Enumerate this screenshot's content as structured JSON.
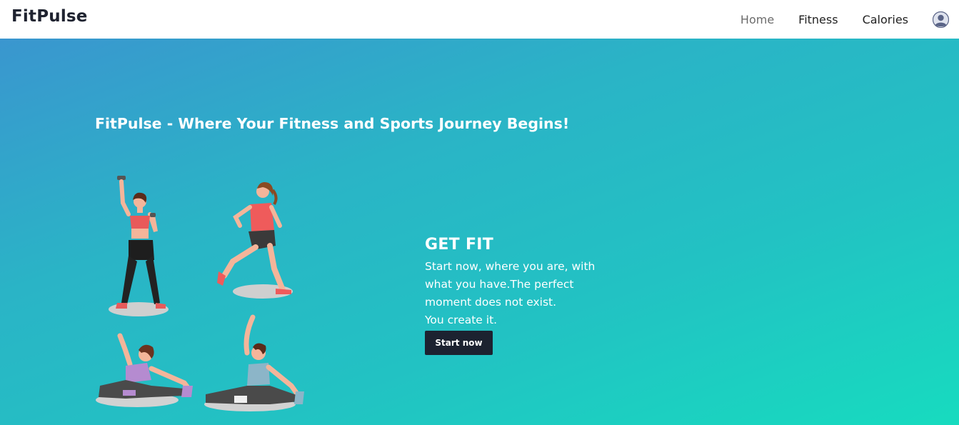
{
  "navbar": {
    "brand": "FitPulse",
    "links": [
      {
        "label": "Home",
        "active": true
      },
      {
        "label": "Fitness",
        "active": false
      },
      {
        "label": "Calories",
        "active": false
      }
    ],
    "avatar_icon": "user-avatar-icon"
  },
  "hero": {
    "title": "FitPulse - Where Your Fitness and Sports Journey Begins!",
    "heading": "GET FIT",
    "text": "Start now, where you are, with what you have.The perfect moment does not exist.\nYou create it.",
    "button_label": "Start now",
    "colors": {
      "gradient_start": "#3a96cf",
      "gradient_end": "#17dbbf",
      "button_bg": "#1c2230"
    }
  }
}
